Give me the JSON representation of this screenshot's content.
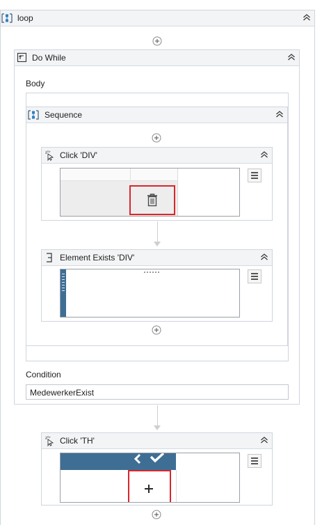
{
  "loop": {
    "title": "loop"
  },
  "do_while": {
    "title": "Do While",
    "body_label": "Body",
    "condition_label": "Condition",
    "condition_value": "MedewerkerExist"
  },
  "sequence": {
    "title": "Sequence"
  },
  "click_div": {
    "title": "Click 'DIV'"
  },
  "element_exists": {
    "title": "Element Exists 'DIV'"
  },
  "click_th": {
    "title": "Click 'TH'"
  },
  "colors": {
    "accent": "#3f6e95",
    "highlight": "#d9262b",
    "header_bg": "#f3f4f6",
    "border": "#cfd6dd"
  }
}
